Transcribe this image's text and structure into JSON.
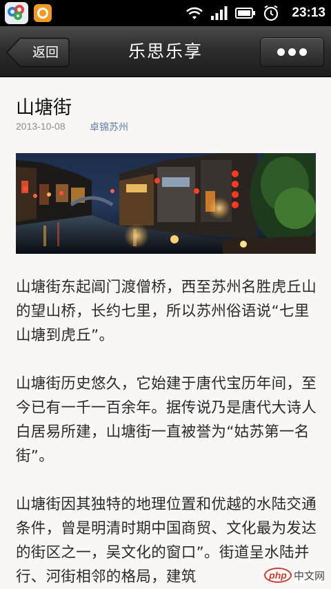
{
  "status_bar": {
    "time": "23:13",
    "icons": [
      "app-shortcut-icon",
      "orange-app-icon",
      "wifi-icon",
      "signal-icon",
      "battery-icon",
      "alarm-icon"
    ]
  },
  "nav": {
    "back_label": "返回",
    "title": "乐思乐享",
    "more_icon": "more-dots-icon"
  },
  "article": {
    "title": "山塘街",
    "date": "2013-10-08",
    "author": "卓锦苏州",
    "paragraphs": [
      "山塘街东起阊门渡僧桥，西至苏州名胜虎丘山的望山桥，长约七里，所以苏州俗语说“七里山塘到虎丘”。",
      "山塘街历史悠久，它始建于唐代宝历年间，至今已有一千一百余年。据传说乃是唐代大诗人白居易所建，山塘街一直被誉为“姑苏第一名街”。",
      "山塘街因其独特的地理位置和优越的水陆交通条件，曾是明清时期中国商贸、文化最为发达的街区之一，吴文化的窗口”。街道呈水陆并行、河街相邻的格局，建筑"
    ]
  },
  "watermark": {
    "logo": "php",
    "site": "中文网"
  },
  "colors": {
    "navbar": "#2d2d2d",
    "author_link": "#607fa6",
    "date": "#8c8c8c",
    "background": "#f8f7f5"
  }
}
